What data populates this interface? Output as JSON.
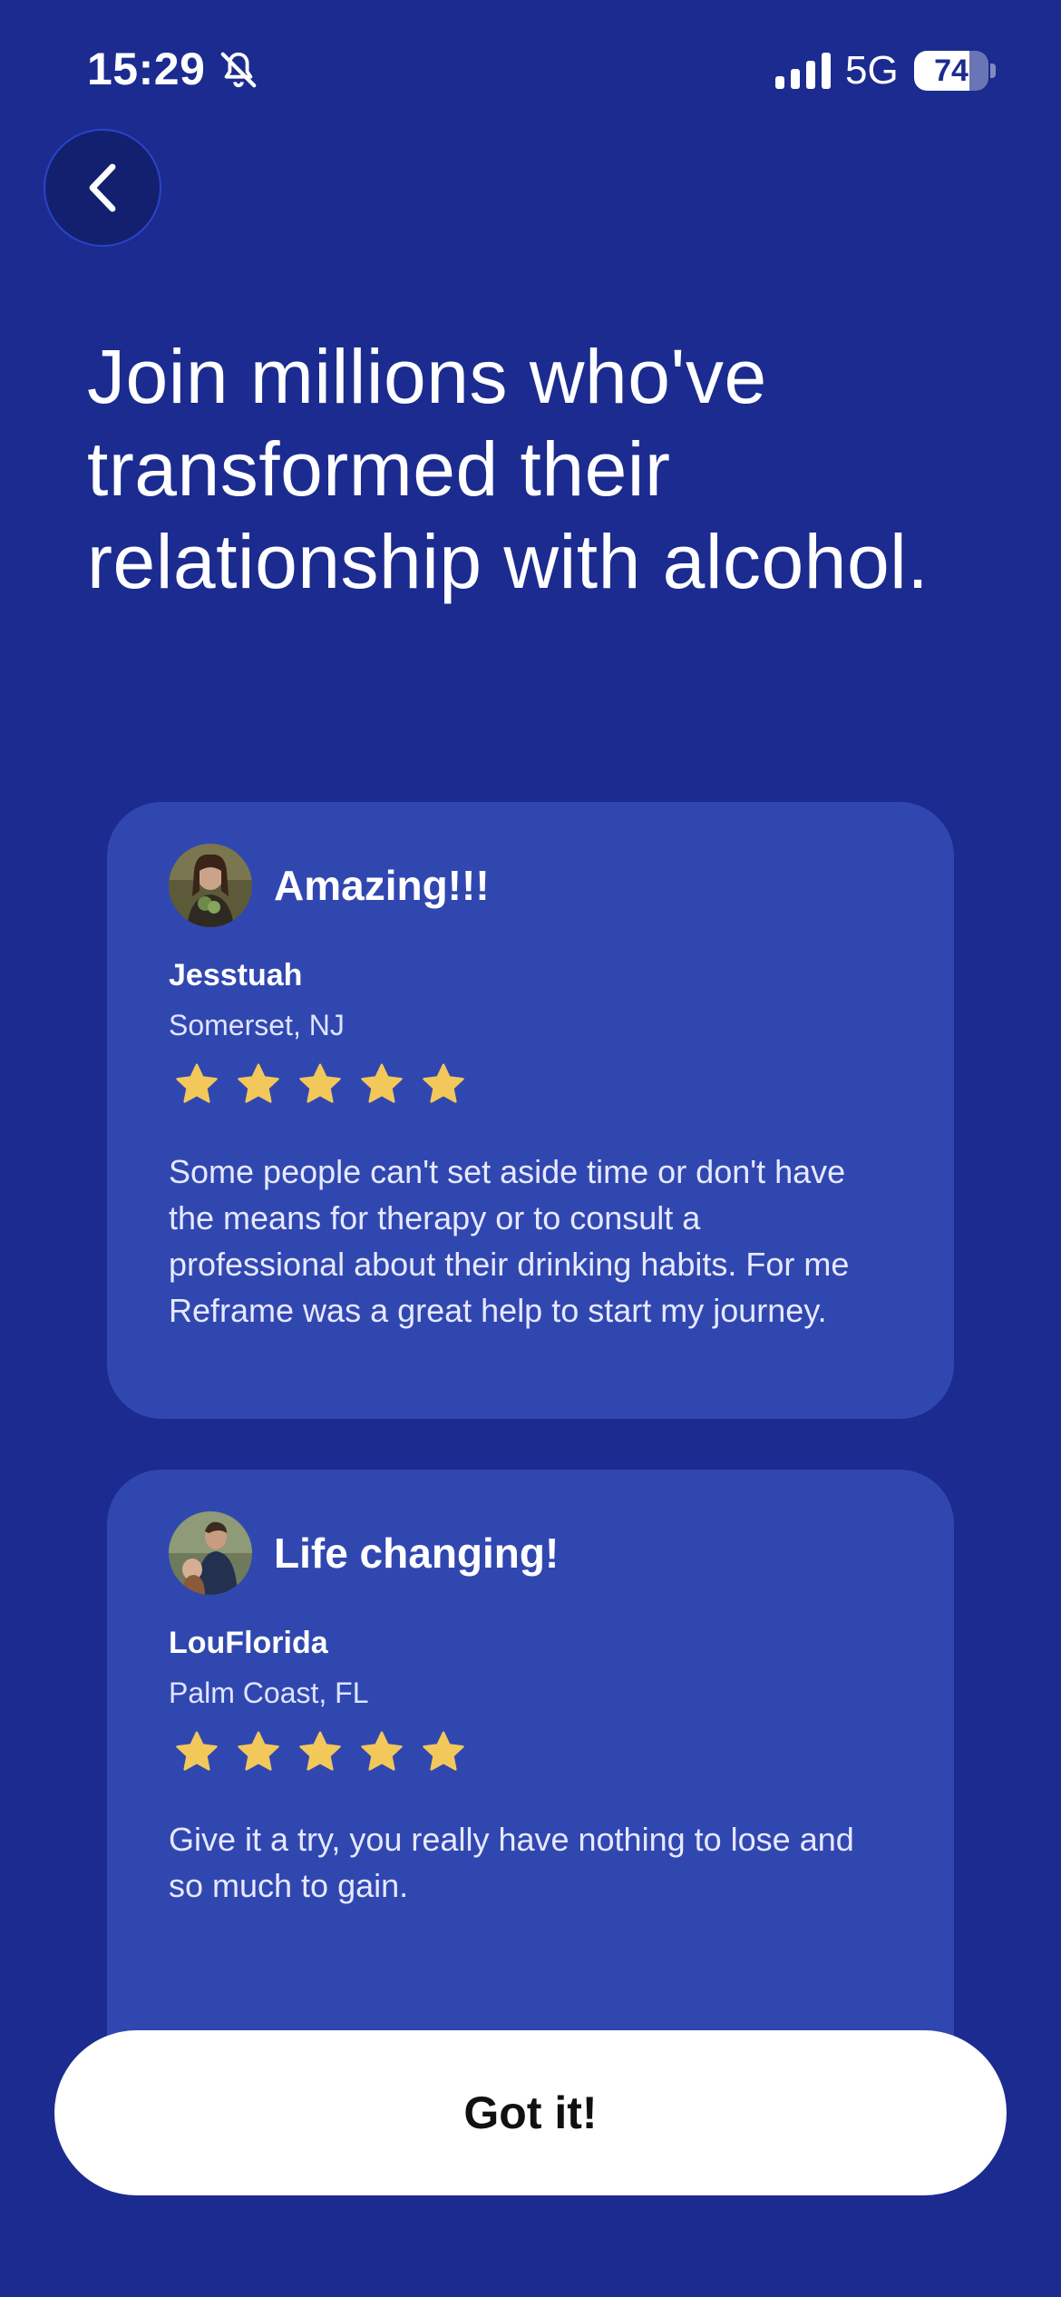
{
  "status_bar": {
    "time": "15:29",
    "network": "5G",
    "battery_percent": "74",
    "battery_level": 0.74,
    "icons": [
      "bell-slash-icon",
      "signal-bars-icon",
      "battery-icon"
    ]
  },
  "navigation": {
    "back_icon": "chevron-left-icon"
  },
  "headline": "Join millions who've transformed their relationship with alcohol.",
  "reviews": [
    {
      "title": "Amazing!!!",
      "name": "Jesstuah",
      "location": "Somerset, NJ",
      "rating": 5,
      "body": "Some people can't set aside time or don't have the means for therapy or to consult a professional about their drinking habits. For me Reframe was a great help to start my journey."
    },
    {
      "title": "Life changing!",
      "name": "LouFlorida",
      "location": "Palm Coast, FL",
      "rating": 5,
      "body": "Give it a try, you really have nothing to lose and so much to gain."
    }
  ],
  "cta": {
    "label": "Got it!"
  },
  "colors": {
    "background": "#1b2b8f",
    "card": "#3147b0",
    "star": "#f3c85a",
    "button": "#ffffff"
  }
}
